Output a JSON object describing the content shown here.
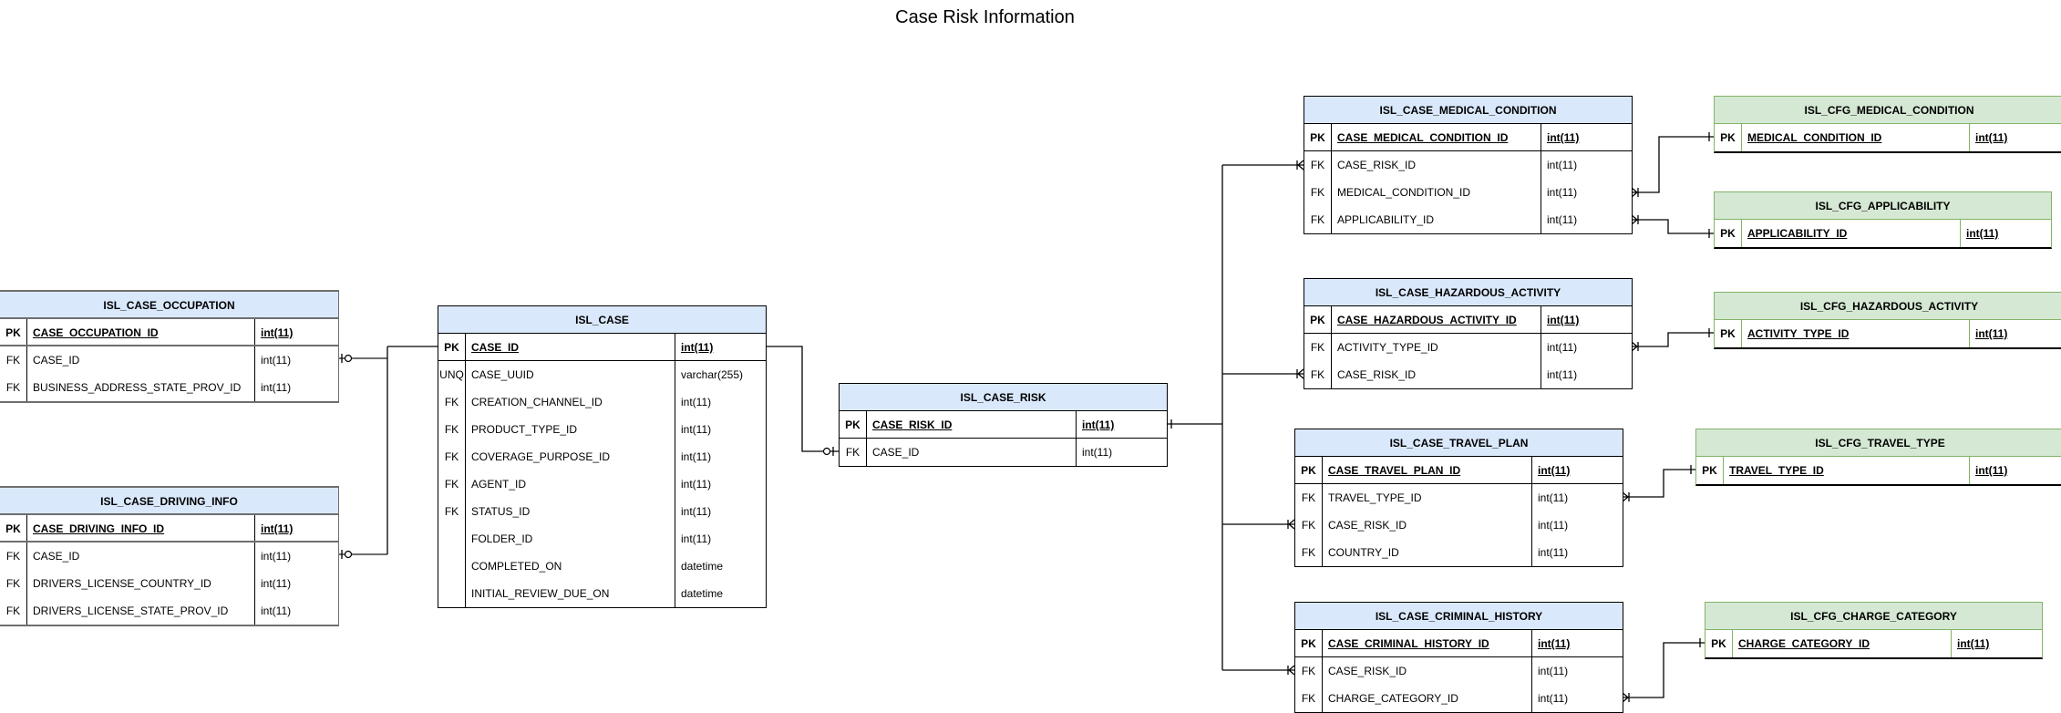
{
  "title": "Case Risk Information",
  "colors": {
    "core_header": "#dae8fc",
    "config_header": "#d5e8d4",
    "config_border": "#82b366"
  },
  "entities": {
    "case_occupation": {
      "name": "ISL_CASE_OCCUPATION",
      "pk": {
        "key": "PK",
        "column": "CASE_OCCUPATION_ID",
        "type": "int(11)"
      },
      "rows": [
        {
          "key": "FK",
          "column": "CASE_ID",
          "type": "int(11)"
        },
        {
          "key": "FK",
          "column": "BUSINESS_ADDRESS_STATE_PROV_ID",
          "type": "int(11)"
        }
      ]
    },
    "case_driving_info": {
      "name": "ISL_CASE_DRIVING_INFO",
      "pk": {
        "key": "PK",
        "column": "CASE_DRIVING_INFO_ID",
        "type": "int(11)"
      },
      "rows": [
        {
          "key": "FK",
          "column": "CASE_ID",
          "type": "int(11)"
        },
        {
          "key": "FK",
          "column": "DRIVERS_LICENSE_COUNTRY_ID",
          "type": "int(11)"
        },
        {
          "key": "FK",
          "column": "DRIVERS_LICENSE_STATE_PROV_ID",
          "type": "int(11)"
        }
      ]
    },
    "case": {
      "name": "ISL_CASE",
      "pk": {
        "key": "PK",
        "column": "CASE_ID",
        "type": "int(11)"
      },
      "rows": [
        {
          "key": "UNQ",
          "column": "CASE_UUID",
          "type": "varchar(255)"
        },
        {
          "key": "FK",
          "column": "CREATION_CHANNEL_ID",
          "type": "int(11)"
        },
        {
          "key": "FK",
          "column": "PRODUCT_TYPE_ID",
          "type": "int(11)"
        },
        {
          "key": "FK",
          "column": "COVERAGE_PURPOSE_ID",
          "type": "int(11)"
        },
        {
          "key": "FK",
          "column": "AGENT_ID",
          "type": "int(11)"
        },
        {
          "key": "FK",
          "column": "STATUS_ID",
          "type": "int(11)"
        },
        {
          "key": "",
          "column": "FOLDER_ID",
          "type": "int(11)"
        },
        {
          "key": "",
          "column": "COMPLETED_ON",
          "type": "datetime"
        },
        {
          "key": "",
          "column": "INITIAL_REVIEW_DUE_ON",
          "type": "datetime"
        }
      ]
    },
    "case_risk": {
      "name": "ISL_CASE_RISK",
      "pk": {
        "key": "PK",
        "column": "CASE_RISK_ID",
        "type": "int(11)"
      },
      "rows": [
        {
          "key": "FK",
          "column": "CASE_ID",
          "type": "int(11)"
        }
      ]
    },
    "case_medical_condition": {
      "name": "ISL_CASE_MEDICAL_CONDITION",
      "pk": {
        "key": "PK",
        "column": "CASE_MEDICAL_CONDITION_ID",
        "type": "int(11)"
      },
      "rows": [
        {
          "key": "FK",
          "column": "CASE_RISK_ID",
          "type": "int(11)"
        },
        {
          "key": "FK",
          "column": "MEDICAL_CONDITION_ID",
          "type": "int(11)"
        },
        {
          "key": "FK",
          "column": "APPLICABILITY_ID",
          "type": "int(11)"
        }
      ]
    },
    "case_hazardous_activity": {
      "name": "ISL_CASE_HAZARDOUS_ACTIVITY",
      "pk": {
        "key": "PK",
        "column": "CASE_HAZARDOUS_ACTIVITY_ID",
        "type": "int(11)"
      },
      "rows": [
        {
          "key": "FK",
          "column": "ACTIVITY_TYPE_ID",
          "type": "int(11)"
        },
        {
          "key": "FK",
          "column": "CASE_RISK_ID",
          "type": "int(11)"
        }
      ]
    },
    "case_travel_plan": {
      "name": "ISL_CASE_TRAVEL_PLAN",
      "pk": {
        "key": "PK",
        "column": "CASE_TRAVEL_PLAN_ID",
        "type": "int(11)"
      },
      "rows": [
        {
          "key": "FK",
          "column": "TRAVEL_TYPE_ID",
          "type": "int(11)"
        },
        {
          "key": "FK",
          "column": "CASE_RISK_ID",
          "type": "int(11)"
        },
        {
          "key": "FK",
          "column": "COUNTRY_ID",
          "type": "int(11)"
        }
      ]
    },
    "case_criminal_history": {
      "name": "ISL_CASE_CRIMINAL_HISTORY",
      "pk": {
        "key": "PK",
        "column": "CASE_CRIMINAL_HISTORY_ID",
        "type": "int(11)"
      },
      "rows": [
        {
          "key": "FK",
          "column": "CASE_RISK_ID",
          "type": "int(11)"
        },
        {
          "key": "FK",
          "column": "CHARGE_CATEGORY_ID",
          "type": "int(11)"
        }
      ]
    },
    "cfg_medical_condition": {
      "name": "ISL_CFG_MEDICAL_CONDITION",
      "pk": {
        "key": "PK",
        "column": "MEDICAL_CONDITION_ID",
        "type": "int(11)"
      }
    },
    "cfg_applicability": {
      "name": "ISL_CFG_APPLICABILITY",
      "pk": {
        "key": "PK",
        "column": "APPLICABILITY_ID",
        "type": "int(11)"
      }
    },
    "cfg_hazardous_activity": {
      "name": "ISL_CFG_HAZARDOUS_ACTIVITY",
      "pk": {
        "key": "PK",
        "column": "ACTIVITY_TYPE_ID",
        "type": "int(11)"
      }
    },
    "cfg_travel_type": {
      "name": "ISL_CFG_TRAVEL_TYPE",
      "pk": {
        "key": "PK",
        "column": "TRAVEL_TYPE_ID",
        "type": "int(11)"
      }
    },
    "cfg_charge_category": {
      "name": "ISL_CFG_CHARGE_CATEGORY",
      "pk": {
        "key": "PK",
        "column": "CHARGE_CATEGORY_ID",
        "type": "int(11)"
      }
    }
  },
  "relationships": [
    {
      "from": "ISL_CASE_OCCUPATION.CASE_ID",
      "to": "ISL_CASE.CASE_ID",
      "cardinality": "zero-or-one to one"
    },
    {
      "from": "ISL_CASE_DRIVING_INFO.CASE_ID",
      "to": "ISL_CASE.CASE_ID",
      "cardinality": "zero-or-one to one"
    },
    {
      "from": "ISL_CASE_RISK.CASE_ID",
      "to": "ISL_CASE.CASE_ID",
      "cardinality": "zero-or-one to one"
    },
    {
      "from": "ISL_CASE_MEDICAL_CONDITION.CASE_RISK_ID",
      "to": "ISL_CASE_RISK.CASE_RISK_ID",
      "cardinality": "one-or-many to one"
    },
    {
      "from": "ISL_CASE_HAZARDOUS_ACTIVITY.CASE_RISK_ID",
      "to": "ISL_CASE_RISK.CASE_RISK_ID",
      "cardinality": "one-or-many to one"
    },
    {
      "from": "ISL_CASE_TRAVEL_PLAN.CASE_RISK_ID",
      "to": "ISL_CASE_RISK.CASE_RISK_ID",
      "cardinality": "one-or-many to one"
    },
    {
      "from": "ISL_CASE_CRIMINAL_HISTORY.CASE_RISK_ID",
      "to": "ISL_CASE_RISK.CASE_RISK_ID",
      "cardinality": "one-or-many to one"
    },
    {
      "from": "ISL_CASE_MEDICAL_CONDITION.MEDICAL_CONDITION_ID",
      "to": "ISL_CFG_MEDICAL_CONDITION.MEDICAL_CONDITION_ID",
      "cardinality": "one-or-many to one"
    },
    {
      "from": "ISL_CASE_MEDICAL_CONDITION.APPLICABILITY_ID",
      "to": "ISL_CFG_APPLICABILITY.APPLICABILITY_ID",
      "cardinality": "one-or-many to one"
    },
    {
      "from": "ISL_CASE_HAZARDOUS_ACTIVITY.ACTIVITY_TYPE_ID",
      "to": "ISL_CFG_HAZARDOUS_ACTIVITY.ACTIVITY_TYPE_ID",
      "cardinality": "one-or-many to one"
    },
    {
      "from": "ISL_CASE_TRAVEL_PLAN.TRAVEL_TYPE_ID",
      "to": "ISL_CFG_TRAVEL_TYPE.TRAVEL_TYPE_ID",
      "cardinality": "one-or-many to one"
    },
    {
      "from": "ISL_CASE_CRIMINAL_HISTORY.CHARGE_CATEGORY_ID",
      "to": "ISL_CFG_CHARGE_CATEGORY.CHARGE_CATEGORY_ID",
      "cardinality": "one-or-many to one"
    }
  ]
}
